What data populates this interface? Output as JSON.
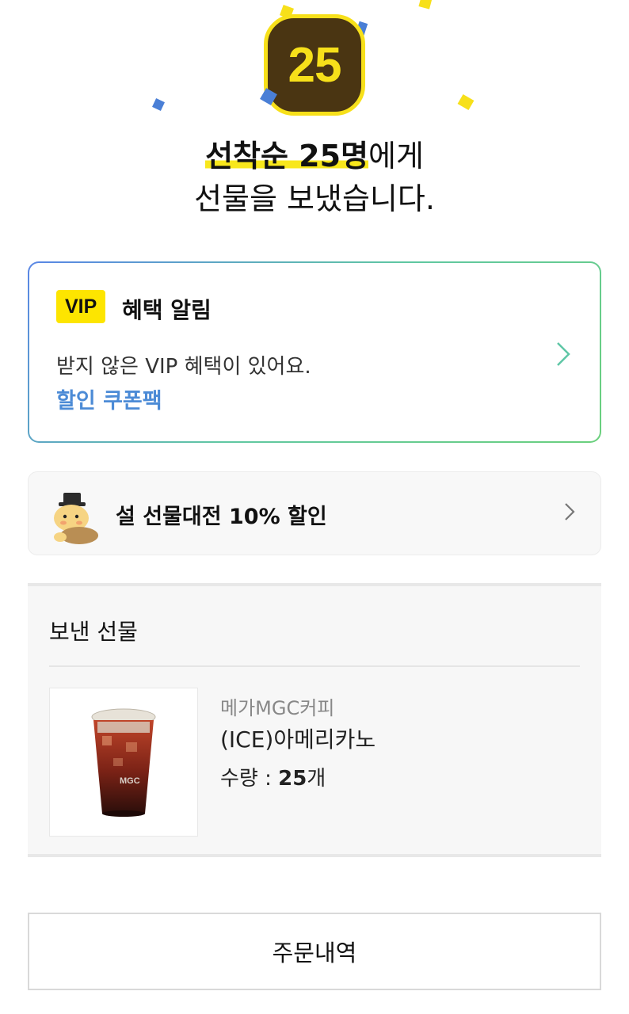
{
  "badge": {
    "count": "25"
  },
  "headline": {
    "highlight": "선착순 25명",
    "line1_rest": "에게",
    "line2": "선물을 보냈습니다."
  },
  "vip_card": {
    "tag": "VIP",
    "title": "혜택 알림",
    "message": "받지 않은 VIP 혜택이 있어요.",
    "link": "할인 쿠폰팩",
    "icon": "chevron-right-icon"
  },
  "promo": {
    "label": "설 선물대전 10% 할인",
    "icon": "chevron-right-icon"
  },
  "gift": {
    "section_title": "보낸 선물",
    "brand": "메가MGC커피",
    "product": "(ICE)아메리카노",
    "qty_label": "수량 : ",
    "qty_value": "25",
    "qty_unit": "개"
  },
  "order_button": {
    "label": "주문내역"
  },
  "colors": {
    "accent_yellow": "#f8e71c",
    "badge_brown": "#4a3512",
    "link_blue": "#4c8bd6",
    "confetti_blue": "#4a7fd6"
  }
}
